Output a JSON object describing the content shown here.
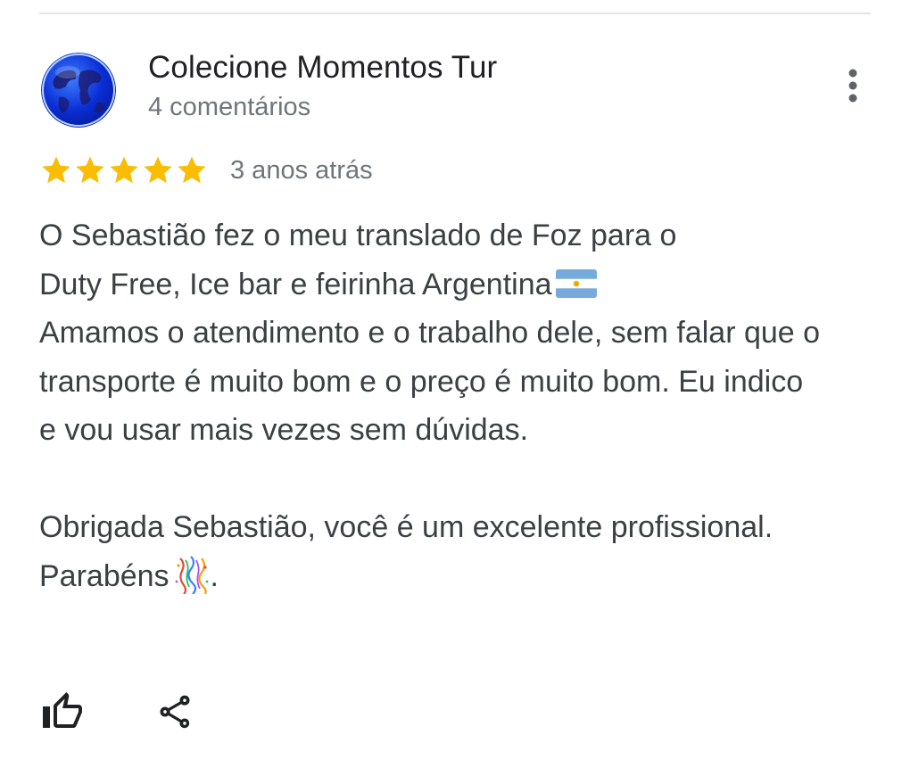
{
  "review": {
    "author_name": "Colecione Momentos Tur",
    "author_meta": "4 comentários",
    "rating": 5,
    "rating_max": 5,
    "date": "3 anos atrás",
    "paragraph_1_line_1": "O Sebastião fez o meu translado de Foz para o",
    "paragraph_1_line_2": "Duty Free, Ice bar e feirinha Argentina",
    "paragraph_1_rest": "Amamos o atendimento e o trabalho dele, sem falar que o transporte é muito bom e o preço é muito bom. Eu indico e vou usar mais vezes sem dúvidas.",
    "paragraph_2_main": "Obrigada Sebastião, você é um excelente profissional. Parabéns",
    "paragraph_2_end": ".",
    "flag_emoji": "argentina-flag",
    "confetti_emoji": "confetti-ball"
  },
  "icons": {
    "avatar": "globe-avatar",
    "more": "more-vert-icon",
    "star": "star-icon",
    "like": "thumb-up-icon",
    "share": "share-icon"
  },
  "colors": {
    "star": "#fbbc04",
    "meta_text": "#70757a",
    "body_text": "#3c4043",
    "name_text": "#202124",
    "icon": "#202124",
    "divider": "#e3e3e3"
  }
}
